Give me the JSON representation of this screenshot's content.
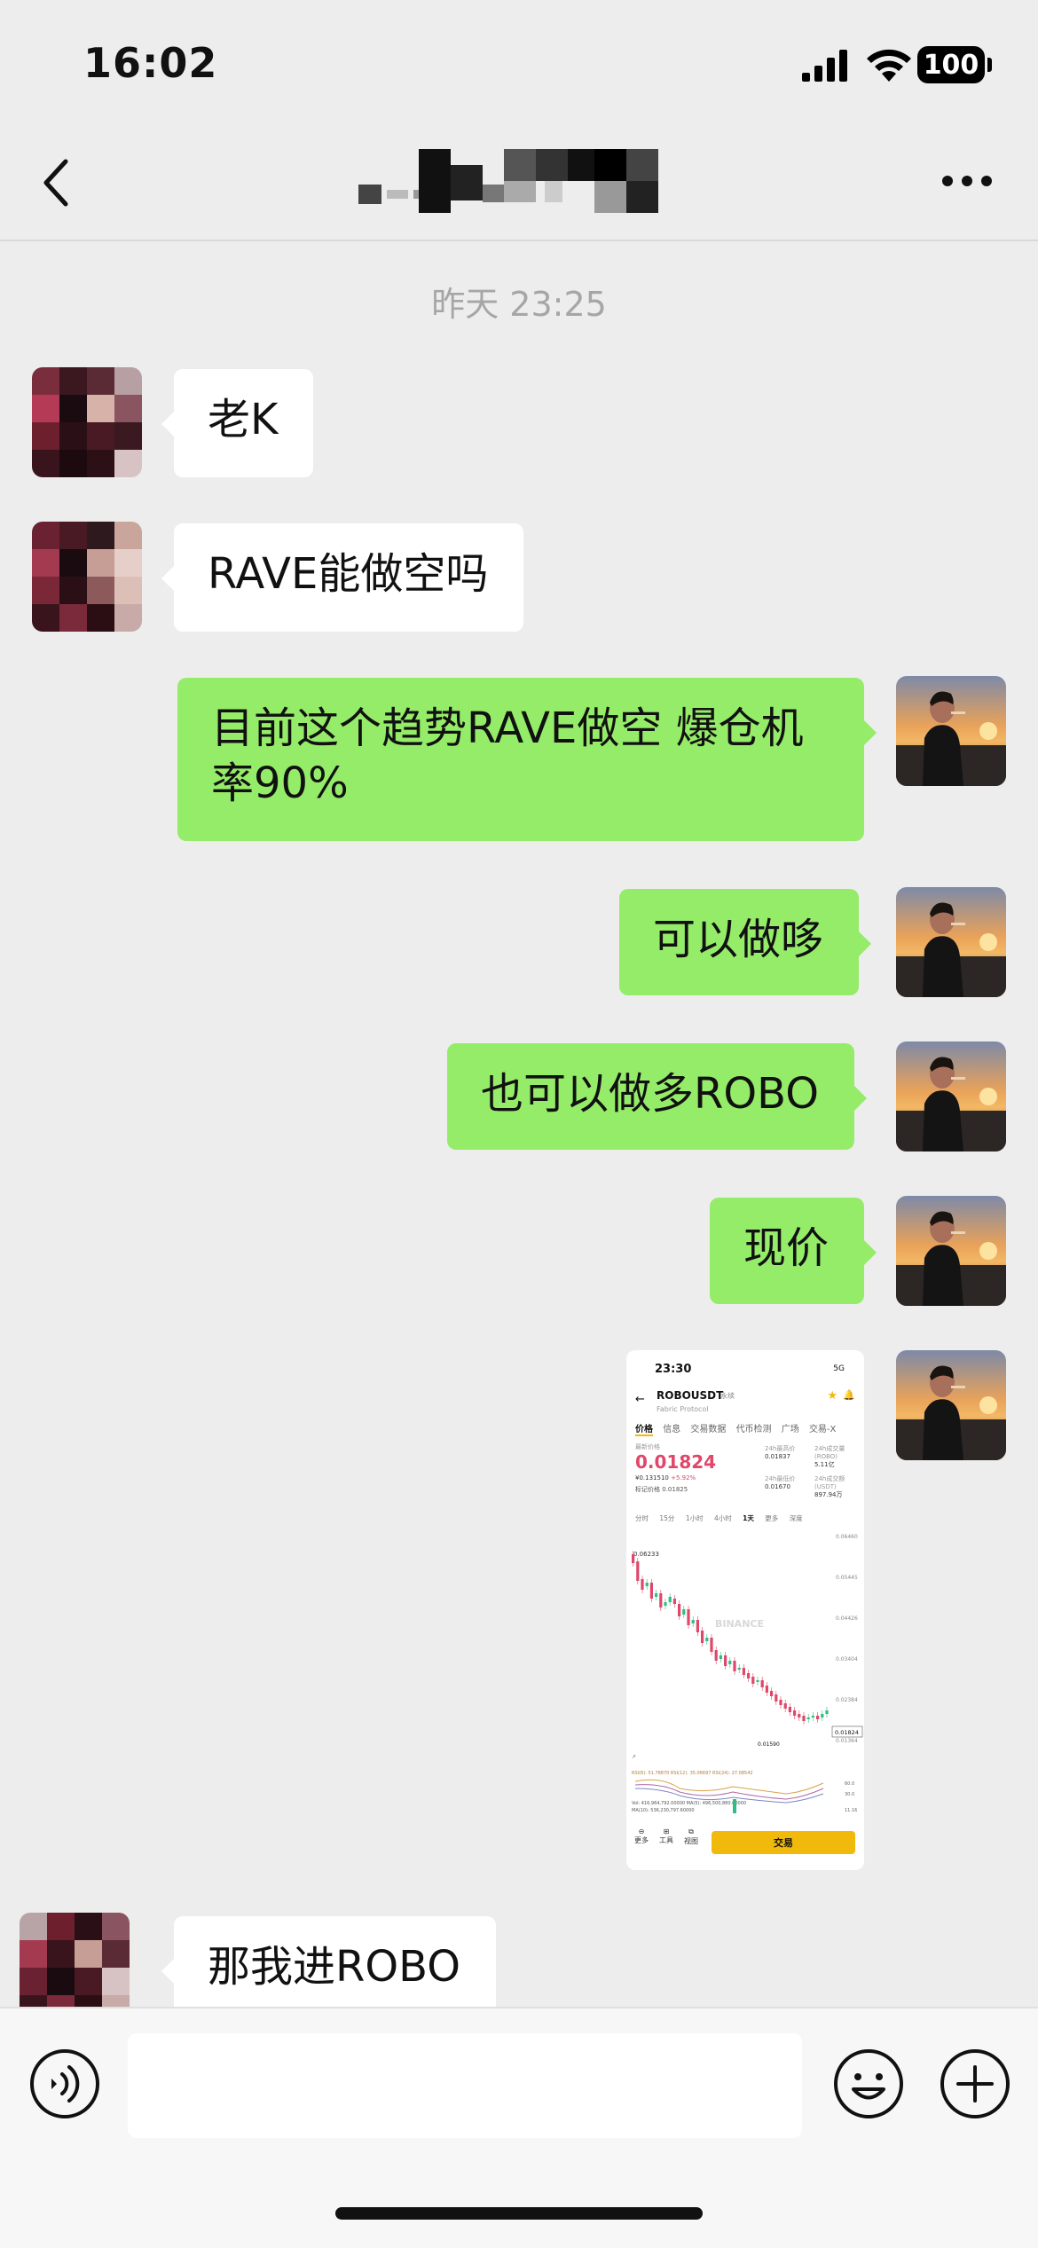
{
  "status_bar": {
    "time": "16:02",
    "battery": "100",
    "icons": [
      "signal-icon",
      "wifi-icon",
      "battery-icon"
    ]
  },
  "nav": {
    "back_icon": "chevron-left-icon",
    "more_icon": "ellipsis-icon"
  },
  "chat": {
    "timestamp": "昨天 23:25",
    "messages": [
      {
        "from": "other",
        "text": "老K"
      },
      {
        "from": "other",
        "text": "RAVE能做空吗"
      },
      {
        "from": "me",
        "text": "目前这个趋势RAVE做空 爆仓机率90%"
      },
      {
        "from": "me",
        "text": "可以做哆"
      },
      {
        "from": "me",
        "text": "也可以做多ROBO"
      },
      {
        "from": "me",
        "text": "现价"
      },
      {
        "from": "me",
        "type": "image"
      },
      {
        "from": "other",
        "text": "那我进ROBO"
      }
    ]
  },
  "screenshot": {
    "time": "23:30",
    "status": "5G",
    "pair": "ROBOUSDT",
    "perp": "永续",
    "subtitle": "Fabric Protocol",
    "tabs": [
      "价格",
      "信息",
      "交易数据",
      "代币检测",
      "广场",
      "交易-X"
    ],
    "last_price_label": "最新价格",
    "price": "0.01824",
    "fiat": "¥0.131510",
    "change": "+5.92%",
    "mark_label": "标记价格",
    "mark_value": "0.01825",
    "stats": [
      {
        "label": "24h最高价",
        "value": "0.01837"
      },
      {
        "label": "24h成交量(ROBO)",
        "value": "5.11亿"
      },
      {
        "label": "24h最低价",
        "value": "0.01670"
      },
      {
        "label": "24h成交额(USDT)",
        "value": "897.94万"
      }
    ],
    "intervals": [
      "分时",
      "15分",
      "1小时",
      "4小时",
      "1天",
      "更多",
      "深度"
    ],
    "active_interval": "1天",
    "high_label": "0.06233",
    "low_label": "0.01590",
    "current_tag": "0.01824",
    "y_ticks": [
      "0.06460",
      "0.05445",
      "0.04426",
      "0.03404",
      "0.02384",
      "0.01364"
    ],
    "watermark": "BINANCE",
    "indicator_line1": "RSI(6): 51.78870  RSI(12): 35.06697  RSI(24): 27.08542",
    "indicator_line2": "Vol: 416,964,792.00000  MA(5): 496,500,880.00000",
    "indicator_line3": "MA(10): 536,230,797.60000",
    "indicator_right": [
      "60.0",
      "30.0",
      "11.16"
    ],
    "tools": [
      "更多",
      "工具",
      "视图"
    ],
    "trade_button": "交易"
  },
  "input_bar": {
    "placeholder": "",
    "voice_icon": "voice-icon",
    "emoji_icon": "emoji-icon",
    "plus_icon": "plus-icon"
  },
  "colors": {
    "background": "#EDEDED",
    "incoming_bubble": "#FFFFFF",
    "outgoing_bubble": "#95EC69",
    "timestamp": "#A6A6A6",
    "price_red": "#E0476A",
    "binance_yellow": "#F0B90B"
  }
}
